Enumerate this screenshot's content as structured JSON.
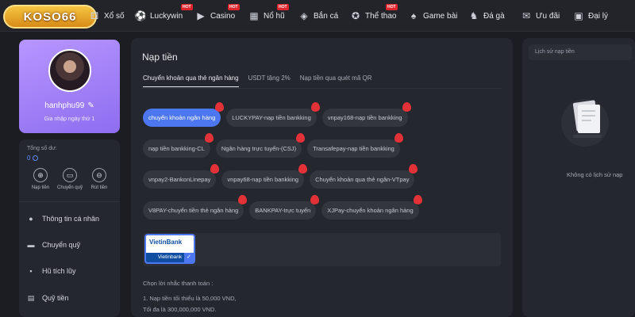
{
  "brand": {
    "logo_text": "KOSO66"
  },
  "nav": {
    "hot_badge": "HOT",
    "items": [
      {
        "label": "Xổ số",
        "icon": "lottery-icon",
        "hot": false
      },
      {
        "label": "Luckywin",
        "icon": "sports-ball-icon",
        "hot": true
      },
      {
        "label": "Casino",
        "icon": "play-icon",
        "hot": true
      },
      {
        "label": "Nổ hũ",
        "icon": "slot-icon",
        "hot": true
      },
      {
        "label": "Bắn cá",
        "icon": "fish-icon",
        "hot": false
      },
      {
        "label": "Thể thao",
        "icon": "soccer-icon",
        "hot": true
      },
      {
        "label": "Game bài",
        "icon": "cards-icon",
        "hot": false
      },
      {
        "label": "Đá gà",
        "icon": "rooster-icon",
        "hot": false
      },
      {
        "label": "Ưu đãi",
        "icon": "gift-icon",
        "hot": false
      },
      {
        "label": "Đại lý",
        "icon": "agent-icon",
        "hot": false
      }
    ]
  },
  "profile": {
    "username": "hanhphu99",
    "login_days": "Gia nhập ngày thứ 1"
  },
  "account": {
    "balance_label": "Tổng số dư:",
    "balance_value": "0",
    "quick_actions": [
      {
        "label": "Nạp tiền",
        "icon": "deposit-icon"
      },
      {
        "label": "Chuyển quỹ",
        "icon": "wallet-icon"
      },
      {
        "label": "Rút tiền",
        "icon": "withdraw-icon"
      }
    ],
    "menu": [
      {
        "label": "Thông tin cá nhân",
        "icon": "user-icon"
      },
      {
        "label": "Chuyển quỹ",
        "icon": "wallet-icon"
      },
      {
        "label": "Hũ tích lũy",
        "icon": "jar-icon"
      },
      {
        "label": "Quỹ tiền",
        "icon": "fund-icon"
      }
    ]
  },
  "deposit": {
    "title": "Nạp tiền",
    "tabs": [
      "Chuyển khoản qua thẻ ngân hàng",
      "USDT tặng 2%",
      "Nạp tiền qua quét mã QR"
    ],
    "active_tab": 0,
    "methods_rows": [
      [
        "chuyển khoản ngân hàng",
        "LUCKYPAY-nạp tiền bankking",
        "vnpay168-nạp tiền bankking"
      ],
      [
        "nạp tiền bankking-CL",
        "Ngân hàng trực tuyến-(CSJ)",
        "Transafepay-nạp tiền bankking"
      ],
      [
        "vnpay2-BankonLinepay",
        "vnpay68-nạp tiền bankking",
        "Chuyển khoản qua thẻ ngân-VTpay"
      ],
      [
        "V8PAY-chuyển tiền thẻ ngân hàng",
        "BANKPAY-trực tuyến",
        "XJPay-chuyển khoản ngân hàng"
      ]
    ],
    "active_method": "chuyển khoản ngân hàng",
    "bank": {
      "logo_text": "VietinBank",
      "name": "Vietinbank"
    },
    "reminder_title": "Chọn lời nhắc thanh toán :",
    "reminder_lines": [
      "1. Nạp tiền tối thiểu là 50,000 VND,",
      "Tối đa là 300,000,000 VND."
    ]
  },
  "history": {
    "title": "Lịch sử nạp tiền",
    "empty_text": "Không có lịch sử nạp"
  },
  "colors": {
    "accent": "#4c77f0",
    "profile_bg": "#a286f9",
    "hot": "#e0242c"
  }
}
